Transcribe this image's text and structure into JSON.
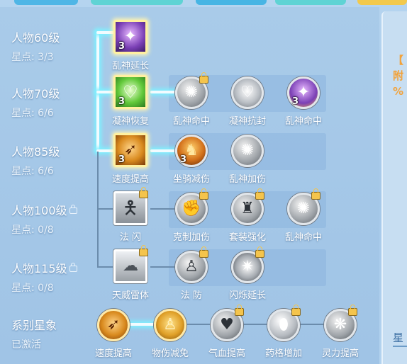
{
  "right_panel": {
    "lines": [
      "【",
      "附",
      "%"
    ],
    "bottom_label": "星"
  },
  "rows": [
    {
      "level": "人物60级",
      "stars": "星点: 3/3",
      "locked": false
    },
    {
      "level": "人物70级",
      "stars": "星点: 6/6",
      "locked": false
    },
    {
      "level": "人物85级",
      "stars": "星点: 6/6",
      "locked": false
    },
    {
      "level": "人物100级",
      "stars": "星点: 0/8",
      "locked": true
    },
    {
      "level": "人物115级",
      "stars": "星点: 0/8",
      "locked": true
    }
  ],
  "nodes": {
    "r1_main": {
      "label": "乱神延长",
      "count": "3",
      "icon": "purple-mask-icon"
    },
    "r2_main": {
      "label": "凝神恢复",
      "count": "3",
      "icon": "green-heart-icon"
    },
    "r2_a": {
      "label": "乱神命中",
      "icon": "swirl-icon",
      "locked": true
    },
    "r2_b": {
      "label": "凝神抗封",
      "icon": "silver-heart-icon"
    },
    "r2_c": {
      "label": "乱神命中",
      "count": "3",
      "icon": "purple-mask-icon"
    },
    "r3_main": {
      "label": "速度提高",
      "count": "3",
      "icon": "speed-fire-icon"
    },
    "r3_a": {
      "label": "坐骑减伤",
      "count": "3",
      "icon": "mount-beast-icon"
    },
    "r3_b": {
      "label": "乱神加伤",
      "icon": "swirl-icon"
    },
    "r4_main": {
      "label": "法 闪",
      "icon": "dodge-figure-icon",
      "locked": true
    },
    "r4_a": {
      "label": "克制加伤",
      "icon": "fist-icon",
      "locked": true
    },
    "r4_b": {
      "label": "套装强化",
      "icon": "armor-icon",
      "locked": true
    },
    "r4_c": {
      "label": "乱神命中",
      "icon": "swirl-icon",
      "locked": true
    },
    "r5_main": {
      "label": "天威雷体",
      "icon": "thunder-body-icon",
      "locked": true
    },
    "r5_a": {
      "label": "法 防",
      "icon": "guard-figure-icon",
      "locked": true
    },
    "r5_b": {
      "label": "闪烁延长",
      "icon": "burst-icon",
      "locked": true
    }
  },
  "series": {
    "title": "系别星象",
    "status": "已激活",
    "items": [
      {
        "label": "速度提高",
        "icon": "speed-fire-icon",
        "active": true
      },
      {
        "label": "物伤减免",
        "icon": "guard-figure-icon",
        "active": true
      },
      {
        "label": "气血提高",
        "icon": "heart-icon",
        "locked": true
      },
      {
        "label": "药格增加",
        "icon": "potion-icon",
        "locked": true
      },
      {
        "label": "灵力提高",
        "icon": "spirit-icon",
        "locked": true
      }
    ]
  },
  "colors": {
    "accent_glow": "#7ff0ff",
    "lock": "#f4c44c",
    "right_text": "#f2a23a"
  }
}
